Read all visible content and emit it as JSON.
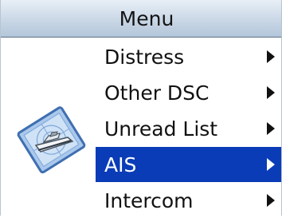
{
  "title": "Menu",
  "menu_items": [
    {
      "label": "Distress"
    },
    {
      "label": "Other DSC"
    },
    {
      "label": "Unread List"
    },
    {
      "label": "AIS"
    },
    {
      "label": "Intercom"
    }
  ],
  "selected_index": 3,
  "icon": "boat-chart-icon",
  "colors": {
    "title_bar": "#c9d7e6",
    "selected_background": "#0a3cb8",
    "selected_text": "#ffffff",
    "text": "#111111"
  }
}
